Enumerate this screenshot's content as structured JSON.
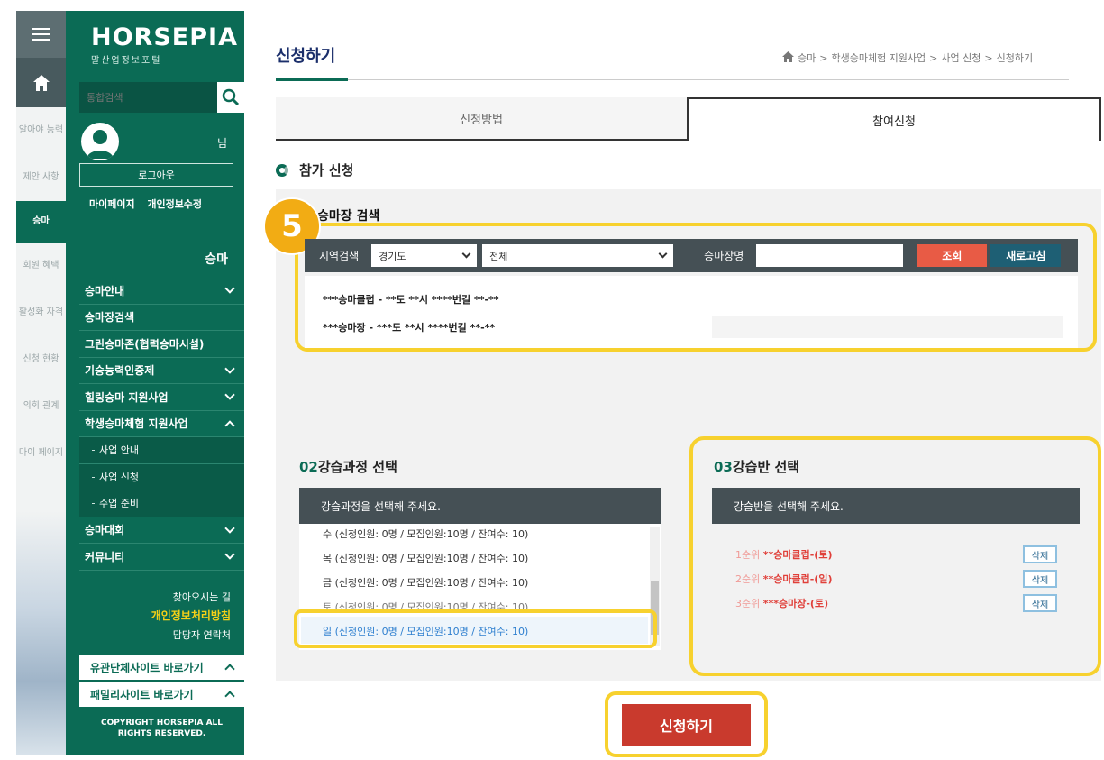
{
  "rail": {
    "items": [
      "알아야 능력",
      "제안 사항",
      "승마",
      "회원 혜택",
      "활성화 자격",
      "신청 현황",
      "의회 관계",
      "마이 페이지"
    ],
    "active": "승마"
  },
  "sidebar": {
    "logo": "HORSEPIA",
    "logo_sub": "말산업정보포털",
    "search_placeholder": "통합검색",
    "user_suffix": "님",
    "logout": "로그아웃",
    "mypage": "마이페이지",
    "profile_edit": "개인정보수정",
    "link_sep": "|",
    "section_title": "승마",
    "nav": [
      {
        "label": "승마안내",
        "chevron": "down"
      },
      {
        "label": "승마장검색",
        "chevron": ""
      },
      {
        "label": "그린승마존(협력승마시설)",
        "chevron": ""
      },
      {
        "label": "기승능력인증제",
        "chevron": "down"
      },
      {
        "label": "힐링승마 지원사업",
        "chevron": "down"
      },
      {
        "label": "학생승마체험 지원사업",
        "chevron": "up"
      },
      {
        "label": "사업 안내",
        "sub": true
      },
      {
        "label": "사업 신청",
        "sub": true
      },
      {
        "label": "수업 준비",
        "sub": true
      },
      {
        "label": "승마대회",
        "chevron": "down"
      },
      {
        "label": "커뮤니티",
        "chevron": "down"
      }
    ],
    "notice_line1": "찾아오시는 길",
    "notice_line2": "개인정보처리방침",
    "notice_line3": "담당자 연락처",
    "family1": "유관단체사이트 바로가기",
    "family2": "패밀리사이트 바로가기",
    "copyright1": "COPYRIGHT HORSEPIA ALL",
    "copyright2": "RIGHTS RESERVED."
  },
  "page": {
    "title": "신청하기",
    "breadcrumb": [
      "승마",
      "학생승마체험 지원사업",
      "사업 신청",
      "신청하기"
    ],
    "tabs": [
      "신청방법",
      "참여신청"
    ],
    "active_tab": "참여신청",
    "section_title": "참가 신청"
  },
  "step5": {
    "badge": "5",
    "title": "승마장 검색",
    "region_label": "지역검색",
    "region_value": "경기도",
    "district_value": "전체",
    "name_label": "승마장명",
    "search_btn": "조회",
    "reset_btn": "새로고침",
    "results": [
      "***승마클럽 - **도 **시 ****번길 **-**",
      "***승마장 - ***도 **시 ****번길 **-**"
    ]
  },
  "step2": {
    "num": "02",
    "title": "강습과정 선택",
    "prompt": "강습과정을 선택해 주세요.",
    "courses": [
      "수 (신청인원: 0명 / 모집인원:10명 / 잔여수: 10)",
      "목 (신청인원: 0명 / 모집인원:10명 / 잔여수: 10)",
      "금 (신청인원: 0명 / 모집인원:10명 / 잔여수: 10)",
      "토 (신청인원: 0명 / 모집인원:10명 / 잔여수: 10)",
      "일 (신청인원: 0명 / 모집인원:10명 / 잔여수: 10)"
    ],
    "selected_index": 4
  },
  "step3": {
    "num": "03",
    "title": "강습반 선택",
    "prompt": "강습반을 선택해 주세요.",
    "classes": [
      {
        "rank": "1순위",
        "name": "**승마클럽-(토)"
      },
      {
        "rank": "2순위",
        "name": "**승마클럽-(일)"
      },
      {
        "rank": "3순위",
        "name": "***승마장-(토)"
      }
    ],
    "delete_btn": "삭제"
  },
  "apply_btn": "신청하기",
  "colors": {
    "brand_green": "#0b6b55",
    "highlight_yellow": "#f7d12e",
    "badge_orange": "#f2ac14",
    "search_red": "#e85b45",
    "apply_red": "#c93a2d"
  }
}
